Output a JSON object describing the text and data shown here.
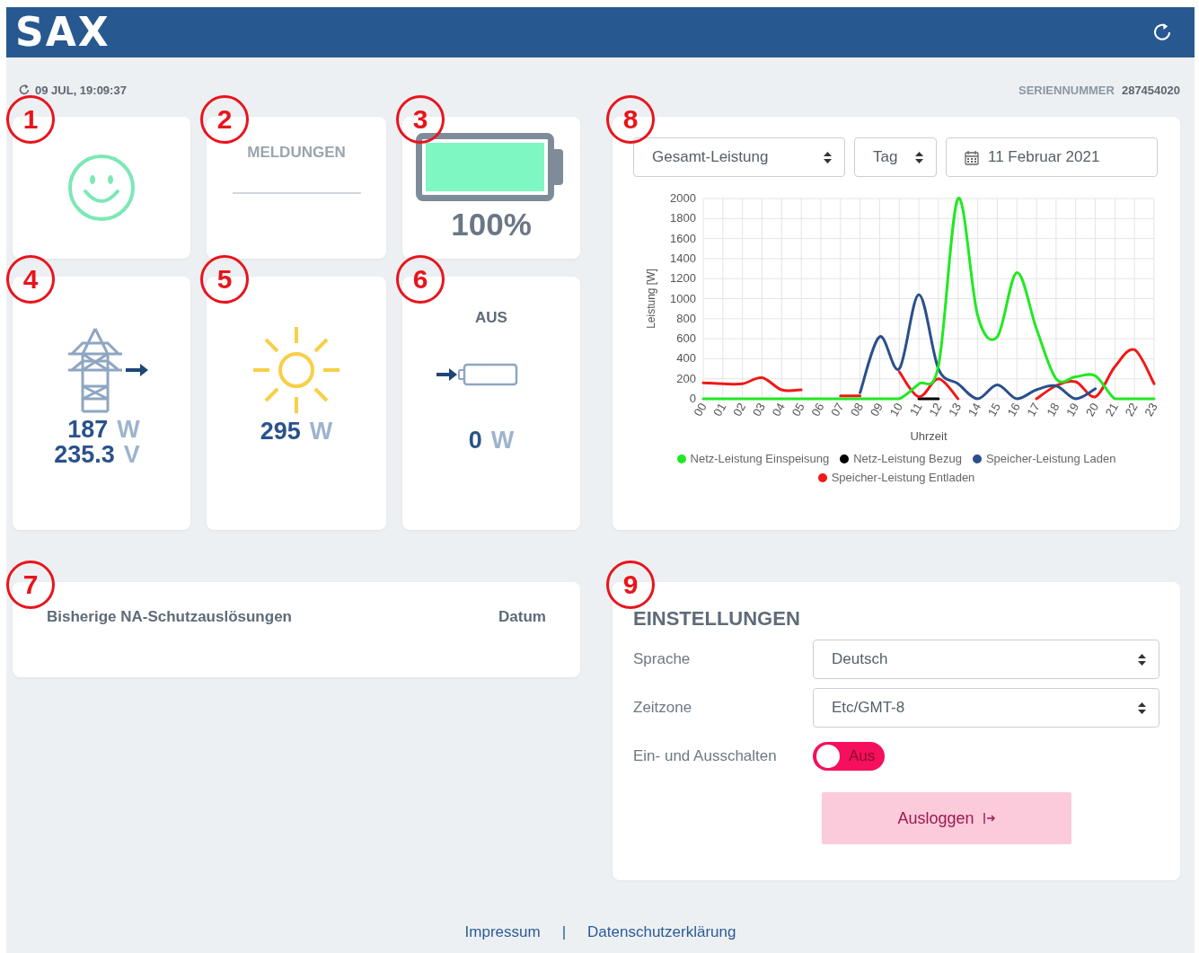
{
  "header": {
    "logo": "SAX"
  },
  "status": {
    "timestamp": "09 JUL, 19:09:37",
    "serial_label": "SERIENNUMMER",
    "serial_number": "287454020"
  },
  "tiles": [
    {
      "kind": "status",
      "callout": "1"
    },
    {
      "kind": "messages",
      "callout": "2",
      "title": "MELDUNGEN"
    },
    {
      "kind": "battery",
      "callout": "3",
      "level": 1.0,
      "reading": "100%"
    },
    {
      "kind": "grid",
      "callout": "4",
      "readings": [
        {
          "value": "187",
          "unit": "W"
        },
        {
          "value": "235.3",
          "unit": "V"
        }
      ]
    },
    {
      "kind": "solar",
      "callout": "5",
      "readings": [
        {
          "value": "295",
          "unit": "W"
        }
      ]
    },
    {
      "kind": "storage",
      "callout": "6",
      "state": "AUS",
      "readings": [
        {
          "value": "0",
          "unit": "W"
        }
      ]
    }
  ],
  "trips": {
    "callout": "7",
    "columns": [
      "Bisherige NA-Schutzauslösungen",
      "Datum"
    ]
  },
  "chart_panel": {
    "callout": "8",
    "selects": [
      "Gesamt-Leistung",
      "Tag"
    ],
    "date": "11 Februar 2021",
    "chart_data": {
      "type": "line",
      "xlabel": "Uhrzeit",
      "ylabel": "Leistung [W]",
      "categories": [
        "00",
        "01",
        "02",
        "03",
        "04",
        "05",
        "06",
        "07",
        "08",
        "09",
        "10",
        "11",
        "12",
        "13",
        "14",
        "15",
        "16",
        "17",
        "18",
        "19",
        "20",
        "21",
        "22",
        "23"
      ],
      "ylim": [
        0,
        2000
      ],
      "grid": true,
      "yticks": [
        0,
        200,
        400,
        600,
        800,
        1000,
        1200,
        1400,
        1600,
        1800,
        2000
      ],
      "series": [
        {
          "name": "Netz-Leistung Einspeisung",
          "color": "#22e822",
          "values": [
            0,
            0,
            0,
            0,
            0,
            0,
            0,
            0,
            0,
            0,
            0,
            150,
            330,
            2000,
            830,
            620,
            1260,
            700,
            200,
            220,
            230,
            0,
            0,
            0
          ]
        },
        {
          "name": "Netz-Leistung Bezug",
          "color": "#000000",
          "values": [
            null,
            null,
            null,
            null,
            null,
            null,
            null,
            null,
            null,
            null,
            null,
            0,
            0,
            null,
            null,
            null,
            null,
            null,
            null,
            null,
            null,
            null,
            null,
            null
          ]
        },
        {
          "name": "Speicher-Leistung Laden",
          "color": "#2b4f8c",
          "values": [
            null,
            null,
            null,
            null,
            null,
            null,
            null,
            null,
            60,
            620,
            300,
            1040,
            300,
            150,
            0,
            140,
            0,
            90,
            130,
            0,
            100,
            null,
            null,
            null
          ]
        },
        {
          "name": "Speicher-Leistung Entladen",
          "color": "#f01818",
          "values": [
            160,
            150,
            150,
            210,
            90,
            90,
            null,
            30,
            30,
            null,
            270,
            20,
            200,
            0,
            null,
            null,
            null,
            0,
            130,
            170,
            20,
            320,
            490,
            150
          ]
        }
      ]
    }
  },
  "settings": {
    "callout": "9",
    "title": "EINSTELLUNGEN",
    "rows": [
      {
        "kind": "select",
        "label": "Sprache",
        "value": "Deutsch"
      },
      {
        "kind": "select",
        "label": "Zeitzone",
        "value": "Etc/GMT-8"
      },
      {
        "kind": "toggle",
        "label": "Ein- und Ausschalten",
        "on": false,
        "state_text": "Aus"
      }
    ],
    "logout": "Ausloggen"
  },
  "footer": {
    "links": [
      "Impressum",
      "Datenschutzerklärung"
    ],
    "separator": "|"
  }
}
